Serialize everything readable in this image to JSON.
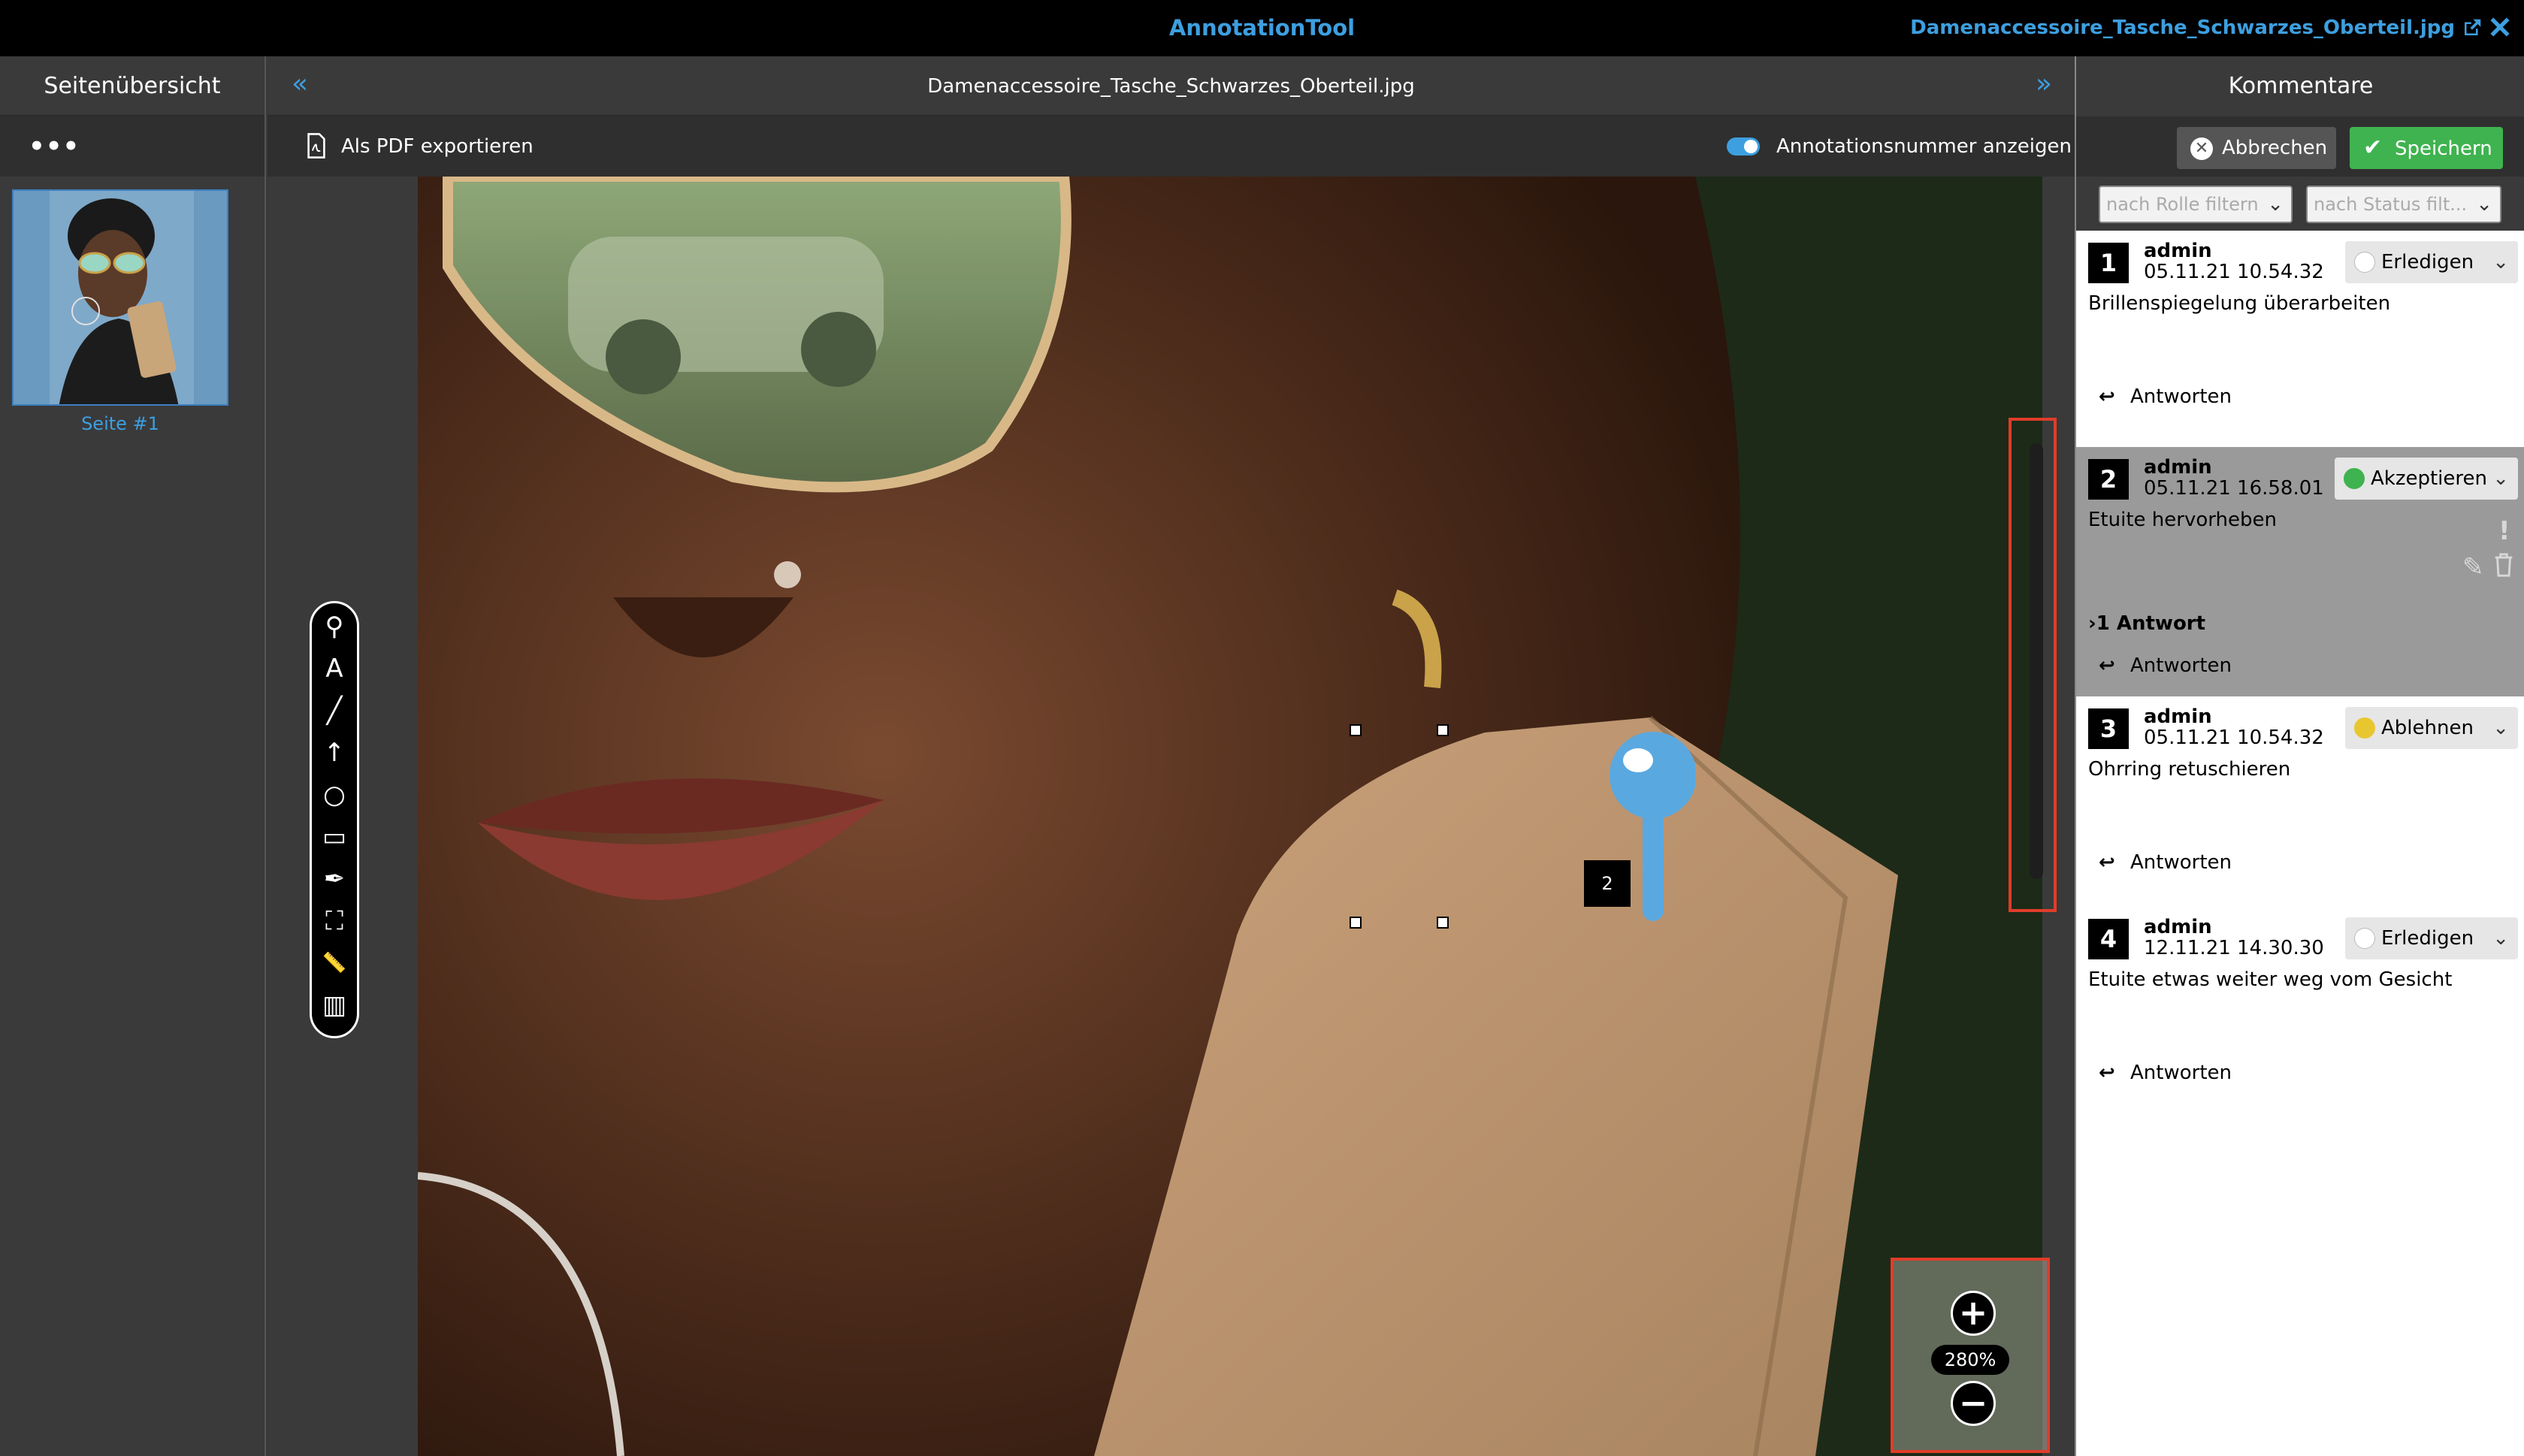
{
  "app": {
    "title": "AnnotationTool",
    "file_title": "Damenaccessoire_Tasche_Schwarzes_Oberteil.jpg"
  },
  "left_panel": {
    "title": "Seitenübersicht",
    "more": "•••",
    "thumbnail_label": "Seite #1"
  },
  "center": {
    "title": "Damenaccessoire_Tasche_Schwarzes_Oberteil.jpg",
    "collapse_left": "«",
    "collapse_right": "»",
    "export_label": "Als PDF exportieren",
    "toggle_label": "Annotationsnummer anzeigen",
    "toggle_on": true,
    "zoom_level": "280%",
    "zoom_in": "+",
    "zoom_out": "−",
    "annotation_marker": "2"
  },
  "toolbar": {
    "tools": [
      {
        "name": "pin-tool-icon",
        "glyph": "⚲"
      },
      {
        "name": "text-tool-icon",
        "glyph": "A"
      },
      {
        "name": "line-tool-icon",
        "glyph": "╱"
      },
      {
        "name": "arrow-tool-icon",
        "glyph": "↑"
      },
      {
        "name": "circle-tool-icon",
        "glyph": "○"
      },
      {
        "name": "rectangle-tool-icon",
        "glyph": "▭"
      },
      {
        "name": "pen-tool-icon",
        "glyph": "✒"
      },
      {
        "name": "transform-tool-icon",
        "glyph": "⛶"
      },
      {
        "name": "ruler-tool-icon",
        "glyph": "📏"
      },
      {
        "name": "library-tool-icon",
        "glyph": "▥"
      }
    ]
  },
  "right_panel": {
    "title": "Kommentare",
    "cancel_label": "Abbrechen",
    "save_label": "Speichern",
    "filter_role": "nach Rolle filtern",
    "filter_status": "nach Status filt...",
    "reply_label": "Antworten",
    "comments": [
      {
        "num": "1",
        "user": "admin",
        "date": "05.11.21 10.54.32",
        "text": "Brillenspiegelung überarbeiten",
        "status": "Erledigen",
        "status_color": "#ffffff"
      },
      {
        "num": "2",
        "user": "admin",
        "date": "05.11.21 16.58.01",
        "text": "Etuite hervorheben",
        "status": "Akzeptieren",
        "status_color": "#3fb34f",
        "answers": "1 Antwort"
      },
      {
        "num": "3",
        "user": "admin",
        "date": "05.11.21 10.54.32",
        "text": "Ohrring retuschieren",
        "status": "Ablehnen",
        "status_color": "#e8c630"
      },
      {
        "num": "4",
        "user": "admin",
        "date": "12.11.21 14.30.30",
        "text": "Etuite etwas weiter weg vom Gesicht",
        "status": "Erledigen",
        "status_color": "#ffffff"
      }
    ]
  },
  "colors": {
    "accent": "#3d9fe0",
    "save": "#3fb34f",
    "highlight": "#e03d2a"
  }
}
